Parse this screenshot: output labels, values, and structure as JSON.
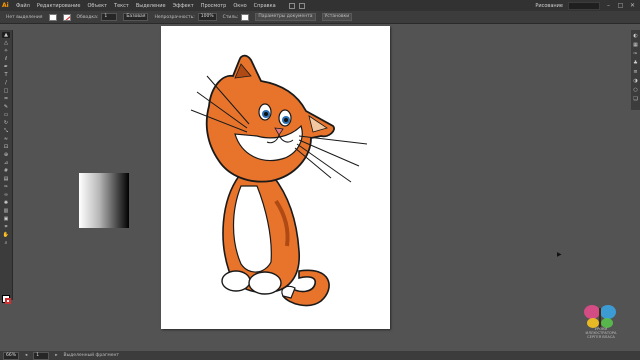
{
  "menubar": {
    "logo": "Ai",
    "items": [
      "Файл",
      "Редактирование",
      "Объект",
      "Текст",
      "Выделение",
      "Эффект",
      "Просмотр",
      "Окно",
      "Справка"
    ],
    "workspace": "Рисование"
  },
  "control": {
    "selection": "Нет выделения",
    "stroke_label": "Обводка:",
    "stroke_value": "1",
    "profile": "Базовая",
    "opacity_label": "Непрозрачность:",
    "opacity_value": "100%",
    "style_label": "Стиль:",
    "doc_setup": "Параметры документа",
    "prefs": "Установки"
  },
  "status": {
    "zoom": "66%",
    "page": "1",
    "label": "Выделенный фрагмент"
  },
  "watermark": {
    "line1": "УРОКИ ИЛЛЮСТРАТОРА",
    "line2": "СЕРГЕЯ ВЛАСА"
  },
  "icons": {
    "tools": [
      "selection-tool-icon",
      "direct-selection-icon",
      "magic-wand-icon",
      "lasso-icon",
      "pen-icon",
      "type-icon",
      "line-icon",
      "rectangle-icon",
      "paintbrush-icon",
      "pencil-icon",
      "eraser-icon",
      "rotate-icon",
      "scale-icon",
      "width-icon",
      "free-transform-icon",
      "shape-builder-icon",
      "perspective-icon",
      "mesh-icon",
      "gradient-icon",
      "eyedropper-icon",
      "blend-icon",
      "symbol-sprayer-icon",
      "graph-icon",
      "artboard-icon",
      "slice-icon",
      "hand-icon",
      "zoom-icon"
    ],
    "panels": [
      "color-panel-icon",
      "swatches-panel-icon",
      "brushes-panel-icon",
      "symbols-panel-icon",
      "stroke-panel-icon",
      "transparency-panel-icon",
      "appearance-panel-icon",
      "layers-panel-icon"
    ]
  },
  "colors": {
    "accent": "#ff9a00",
    "cat_orange": "#e8742c",
    "cat_dark": "#b04a14",
    "workspace_bg": "#535353"
  }
}
